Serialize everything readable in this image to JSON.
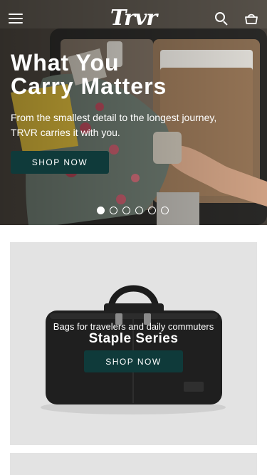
{
  "header": {
    "logo": "Trvr",
    "icons": [
      "hamburger-menu-icon",
      "search-icon",
      "shopping-bag-icon"
    ]
  },
  "hero": {
    "title_line1": "What You",
    "title_line2": "Carry Matters",
    "subtitle_line1": "From the smallest detail to the longest journey,",
    "subtitle_line2": "TRVR carries it with you.",
    "button_label": "SHOP NOW",
    "slides_total": 6,
    "active_slide": 1
  },
  "promo": {
    "subtitle": "Bags for travelers and daily commuters",
    "title": "Staple Series",
    "button_label": "SHOP NOW"
  },
  "colors": {
    "accent": "#0f3a3a",
    "card_background": "#e3e3e3",
    "text_on_image": "#ffffff"
  }
}
